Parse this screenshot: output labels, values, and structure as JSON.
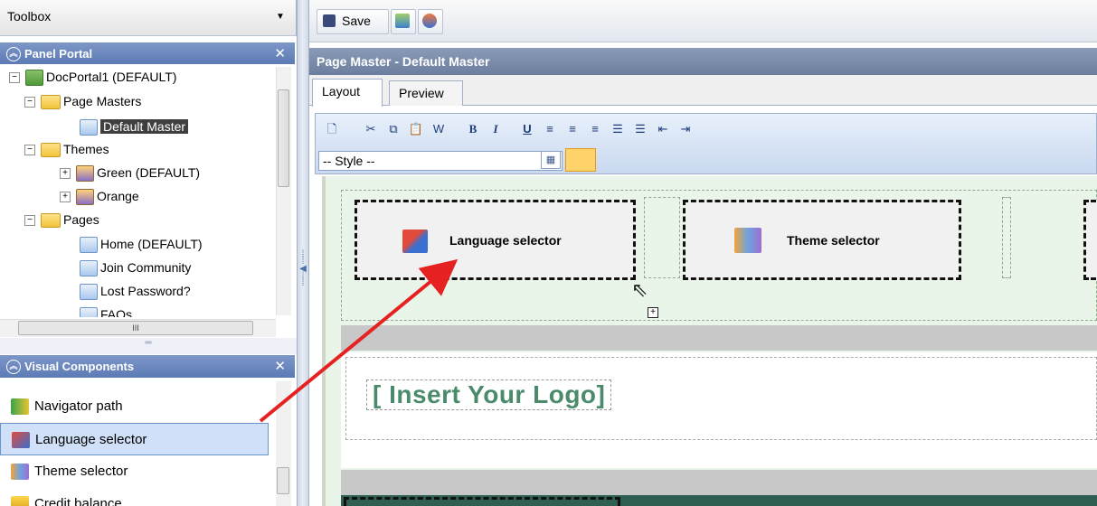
{
  "toolbox": {
    "title": "Toolbox"
  },
  "panel_portal": {
    "title": "Panel Portal"
  },
  "tree": {
    "root": "DocPortal1 (DEFAULT)",
    "page_masters": "Page Masters",
    "default_master": "Default Master",
    "themes": "Themes",
    "theme_green": "Green (DEFAULT)",
    "theme_orange": "Orange",
    "pages": "Pages",
    "page_home": "Home (DEFAULT)",
    "page_join": "Join Community",
    "page_lost": "Lost Password?",
    "page_faqs": "FAQs"
  },
  "visual_components": {
    "title": "Visual Components",
    "items": [
      "Navigator path",
      "Language selector",
      "Theme selector",
      "Credit balance"
    ]
  },
  "toolbar": {
    "save_label": "Save"
  },
  "page_master": {
    "title": "Page Master - Default Master"
  },
  "tabs": {
    "layout": "Layout",
    "preview": "Preview"
  },
  "editor": {
    "style_value": "-- Style --"
  },
  "canvas": {
    "language_selector": "Language selector",
    "theme_selector": "Theme selector",
    "logo_placeholder": "[ Insert Your Logo]"
  }
}
